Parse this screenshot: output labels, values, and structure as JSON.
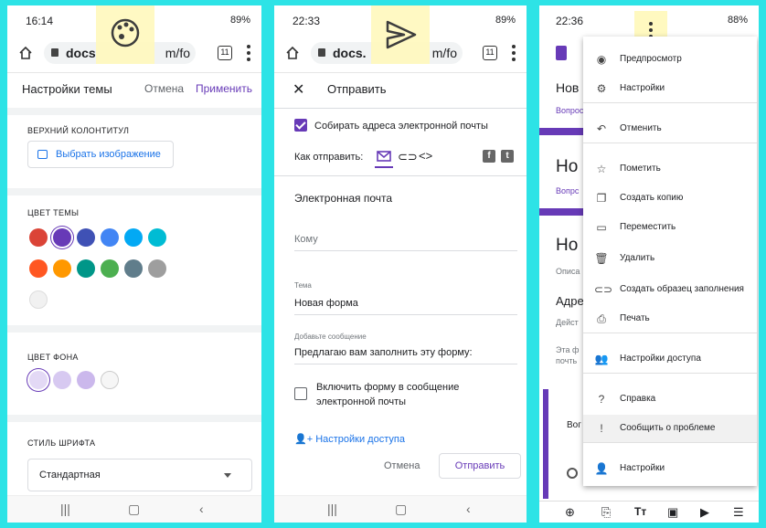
{
  "panel1": {
    "status": {
      "time": "16:14",
      "battery": "89%"
    },
    "url": {
      "host": "docs",
      "path": "m/fo",
      "tabs": "11"
    },
    "overlay_icon": "palette-icon",
    "title": "Настройки темы",
    "cancel": "Отмена",
    "apply": "Применить",
    "header_section": "ВЕРХНИЙ КОЛОНТИТУЛ",
    "choose_image": "Выбрать изображение",
    "theme_color_section": "ЦВЕТ ТЕМЫ",
    "theme_colors": [
      "#db4437",
      "#673ab7",
      "#3f51b5",
      "#4285f4",
      "#03a9f4",
      "#00bcd4",
      "#ff5722",
      "#ff9800",
      "#009688",
      "#4caf50",
      "#607d8b",
      "#9e9e9e"
    ],
    "selected_theme_color": "#673ab7",
    "bg_color_section": "ЦВЕТ ФОНА",
    "bg_colors": [
      "#e3d9f5",
      "#d7c9f1",
      "#cbb8ec",
      "#f6f6f6"
    ],
    "font_section": "СТИЛЬ ШРИФТА",
    "font_value": "Стандартная"
  },
  "panel2": {
    "status": {
      "time": "22:33",
      "battery": "89%"
    },
    "url": {
      "host": "docs.",
      "path": "m/fo",
      "tabs": "11"
    },
    "overlay_icon": "send-icon",
    "title": "Отправить",
    "collect_emails": "Собирать адреса электронной почты",
    "send_via": "Как отправить:",
    "email_heading": "Электронная почта",
    "to_placeholder": "Кому",
    "subject_label": "Тема",
    "subject_value": "Новая форма",
    "message_label": "Добавьте сообщение",
    "message_value": "Предлагаю вам заполнить эту форму:",
    "include_form_line1": "Включить форму в сообщение",
    "include_form_line2": "электронной почты",
    "access_settings": "Настройки доступа",
    "cancel": "Отмена",
    "send": "Отправить"
  },
  "panel3": {
    "status": {
      "time": "22:36",
      "battery": "88%"
    },
    "bg_fragments": [
      "Нов",
      "Вопрос",
      "Но",
      "Вопрс",
      "Но",
      "Описа",
      "Адре",
      "Дейст",
      "Эта ф",
      "почть",
      "Вог"
    ],
    "menu": [
      {
        "label": "Предпросмотр",
        "icon": "eye-icon"
      },
      {
        "label": "Настройки",
        "icon": "gear-icon"
      },
      {
        "label": "Отменить",
        "icon": "undo-icon"
      },
      {
        "label": "Пометить",
        "icon": "star-icon"
      },
      {
        "label": "Создать копию",
        "icon": "copy-icon"
      },
      {
        "label": "Переместить",
        "icon": "folder-icon"
      },
      {
        "label": "Удалить",
        "icon": "trash-icon"
      },
      {
        "label": "Создать образец заполнения",
        "icon": "link-icon"
      },
      {
        "label": "Печать",
        "icon": "print-icon"
      },
      {
        "label": "Настройки доступа",
        "icon": "add-people-icon"
      },
      {
        "label": "Справка",
        "icon": "help-icon"
      },
      {
        "label": "Сообщить о проблеме",
        "icon": "feedback-icon"
      },
      {
        "label": "Настройки",
        "icon": "person-settings-icon"
      }
    ],
    "highlighted_item": "Сообщить о проблеме"
  },
  "accent": "#673ab7",
  "link": "#1a73e8",
  "frame": "#2de3e6"
}
